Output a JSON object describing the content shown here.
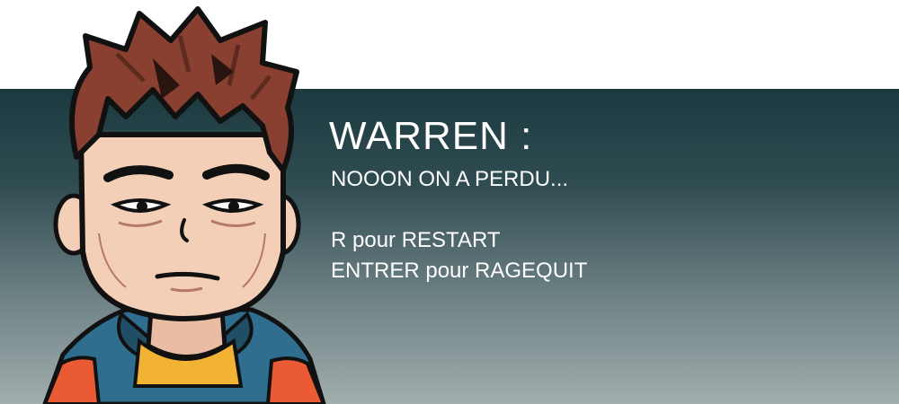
{
  "dialog": {
    "speaker": "WARREN :",
    "message": "NOOON ON A PERDU...",
    "restart_hint": "R pour RESTART",
    "quit_hint": "ENTRER pour RAGEQUIT"
  },
  "colors": {
    "panel_top": "#1b3a40",
    "panel_bottom": "#a2adae",
    "hair": "#8a4030",
    "skin": "#f3cfb8",
    "jacket_blue": "#2f6e8e",
    "jacket_orange": "#ea5a35",
    "shirt_yellow": "#f2b233"
  }
}
